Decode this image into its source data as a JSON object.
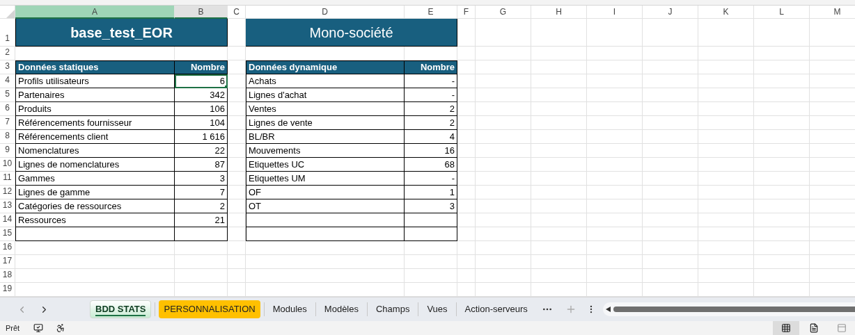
{
  "columns": [
    {
      "label": "A",
      "kind": "active"
    },
    {
      "label": "B",
      "kind": "shaded"
    },
    {
      "label": "C",
      "kind": "plain"
    },
    {
      "label": "D",
      "kind": "plain"
    },
    {
      "label": "E",
      "kind": "plain"
    },
    {
      "label": "F",
      "kind": "plain"
    },
    {
      "label": "G",
      "kind": "plain"
    },
    {
      "label": "H",
      "kind": "plain"
    },
    {
      "label": "I",
      "kind": "plain"
    },
    {
      "label": "J",
      "kind": "plain"
    },
    {
      "label": "K",
      "kind": "plain"
    },
    {
      "label": "L",
      "kind": "plain"
    },
    {
      "label": "M",
      "kind": "plain"
    }
  ],
  "row_numbers": [
    "1",
    "2",
    "3",
    "4",
    "5",
    "6",
    "7",
    "8",
    "9",
    "10",
    "11",
    "12",
    "13",
    "14",
    "15",
    "16",
    "17",
    "18",
    "19"
  ],
  "titles": [
    {
      "text": "base_test_EOR",
      "bold": true
    },
    {
      "text": "Mono-société",
      "bold": false
    }
  ],
  "static_table": {
    "headers": [
      "Données statiques",
      "Nombre"
    ],
    "rows": [
      {
        "label": "Profils utilisateurs",
        "value": "6",
        "selected": true
      },
      {
        "label": "Partenaires",
        "value": "342",
        "selected": false
      },
      {
        "label": "Produits",
        "value": "106",
        "selected": false
      },
      {
        "label": "Référencements fournisseur",
        "value": "104",
        "selected": false
      },
      {
        "label": "Référencements client",
        "value": "1 616",
        "selected": false
      },
      {
        "label": "Nomenclatures",
        "value": "22",
        "selected": false
      },
      {
        "label": "Lignes de nomenclatures",
        "value": "87",
        "selected": false
      },
      {
        "label": "Gammes",
        "value": "3",
        "selected": false
      },
      {
        "label": "Lignes de gamme",
        "value": "7",
        "selected": false
      },
      {
        "label": "Catégories de ressources",
        "value": "2",
        "selected": false
      },
      {
        "label": "Ressources",
        "value": "21",
        "selected": false
      }
    ]
  },
  "dynamic_table": {
    "headers": [
      "Données dynamique",
      "Nombre"
    ],
    "rows": [
      {
        "label": "Achats",
        "value": "-"
      },
      {
        "label": "Lignes d'achat",
        "value": "-"
      },
      {
        "label": "Ventes",
        "value": "2"
      },
      {
        "label": "Lignes de vente",
        "value": "2"
      },
      {
        "label": "BL/BR",
        "value": "4"
      },
      {
        "label": "Mouvements",
        "value": "16"
      },
      {
        "label": "Etiquettes UC",
        "value": "68"
      },
      {
        "label": "Etiquettes UM",
        "value": "-"
      },
      {
        "label": "OF",
        "value": "1"
      },
      {
        "label": "OT",
        "value": "3"
      }
    ]
  },
  "sheet_tabs": [
    {
      "label": "BDD STATS",
      "selected": true
    },
    {
      "label": "PERSONNALISATION",
      "selected": false,
      "color": "#ffc000"
    },
    {
      "label": "Modules",
      "selected": false
    },
    {
      "label": "Modèles",
      "selected": false
    },
    {
      "label": "Champs",
      "selected": false
    },
    {
      "label": "Vues",
      "selected": false
    },
    {
      "label": "Action-serveurs",
      "selected": false
    }
  ],
  "status_bar": {
    "text": "Prêt"
  }
}
